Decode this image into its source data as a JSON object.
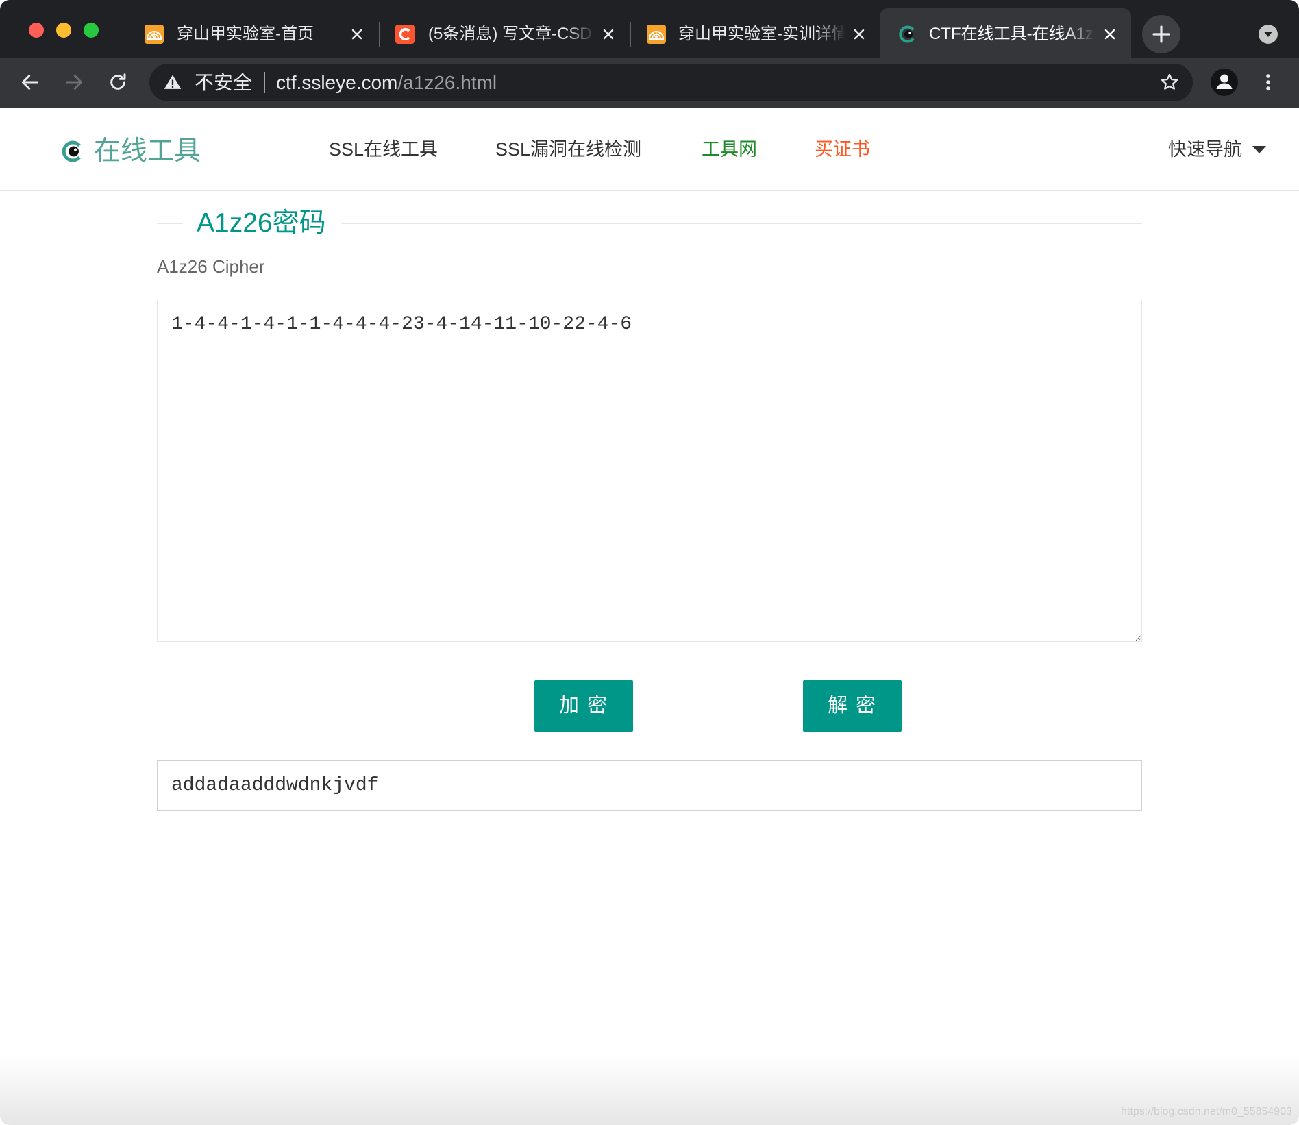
{
  "browser": {
    "tabs": [
      {
        "title": "穿山甲实验室-首页",
        "icon": "pangolin-lab-favicon",
        "active": false
      },
      {
        "title": "(5条消息) 写文章-CSD",
        "icon": "csdn-favicon",
        "active": false
      },
      {
        "title": "穿山甲实验室-实训详情",
        "icon": "pangolin-lab-favicon",
        "active": false
      },
      {
        "title": "CTF在线工具-在线A1z",
        "icon": "ssleye-favicon",
        "active": true
      }
    ],
    "address_bar": {
      "security_label": "不安全",
      "url_host": "ctf.ssleye.com",
      "url_path": "/a1z26.html"
    },
    "icons": {
      "back": "back-arrow-icon",
      "forward": "forward-arrow-icon",
      "reload": "reload-icon",
      "security": "warning-icon",
      "bookmark": "star-icon",
      "profile": "avatar-icon",
      "menu": "kebab-menu-icon",
      "new_tab": "plus-icon",
      "tab_search": "chevron-down-icon",
      "tab_close": "close-icon"
    }
  },
  "site": {
    "logo_text": "在线工具",
    "logo_icon": "eye-logo-icon",
    "nav": [
      {
        "label": "SSL在线工具",
        "color": "#333333"
      },
      {
        "label": "SSL漏洞在线检测",
        "color": "#333333"
      },
      {
        "label": "工具网",
        "color": "#1e8a28"
      },
      {
        "label": "买证书",
        "color": "#ff5722"
      }
    ],
    "quick_nav_label": "快速导航"
  },
  "tool": {
    "title": "A1z26密码",
    "subtitle": "A1z26 Cipher",
    "input_value": "1-4-4-1-4-1-1-4-4-4-23-4-14-11-10-22-4-6",
    "encrypt_label": "加 密",
    "decrypt_label": "解 密",
    "output_value": "addadaadddwdnkjvdf"
  },
  "watermark": "https://blog.csdn.net/m0_55854903",
  "theme": {
    "accent": "#009688",
    "browser_frame": "#202124",
    "browser_toolbar": "#35363a"
  }
}
